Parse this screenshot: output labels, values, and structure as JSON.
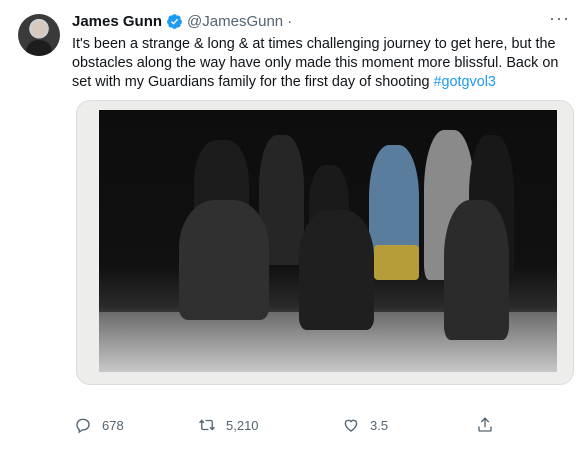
{
  "tweet": {
    "author_name": "James Gunn",
    "handle": "@JamesGunn",
    "separator": "·",
    "more_label": "···",
    "text_main": "It's been a strange & long & at times challenging journey to get here, but the obstacles along the way have only made this moment more blissful. Back on set with my Guardians family for the first day of shooting ",
    "hashtag": "#gotgvol3"
  },
  "actions": {
    "reply_count": "678",
    "retweet_count": "5,210",
    "like_count": "3.5",
    "icons": [
      "reply-icon",
      "retweet-icon",
      "like-icon",
      "share-icon"
    ]
  },
  "colors": {
    "verified": "#1d9bf0",
    "link": "#1d9bf0",
    "text": "#0f1419",
    "muted": "#536471"
  }
}
